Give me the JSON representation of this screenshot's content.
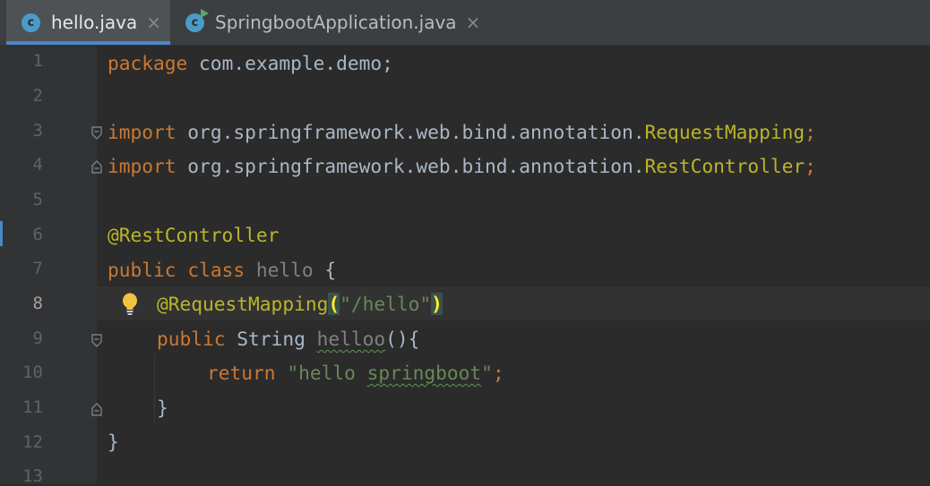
{
  "tabs": [
    {
      "label": "hello.java",
      "icon": "class-icon",
      "active": true
    },
    {
      "label": "SpringbootApplication.java",
      "icon": "class-run-icon",
      "active": false
    }
  ],
  "line_numbers": [
    "1",
    "2",
    "3",
    "4",
    "5",
    "6",
    "7",
    "8",
    "9",
    "10",
    "11",
    "12",
    "13"
  ],
  "current_line": 8,
  "code": {
    "l1": {
      "kw": "package",
      "rest": " com.example.demo;"
    },
    "l3": {
      "kw": "import",
      "pkg": " org.springframework.web.bind.annotation.",
      "cls": "RequestMapping",
      "semi": ";"
    },
    "l4": {
      "kw": "import",
      "pkg": " org.springframework.web.bind.annotation.",
      "cls": "RestController",
      "semi": ";"
    },
    "l6": {
      "ann": "@RestController"
    },
    "l7": {
      "kw1": "public",
      "kw2": "class",
      "name": "hello",
      "brace": " {"
    },
    "l8": {
      "ann": "@RequestMapping",
      "lparen": "(",
      "str": "\"/hello\"",
      "rparen": ")"
    },
    "l9": {
      "kw": "public",
      "type": " String ",
      "method": "helloo",
      "rest": "(){"
    },
    "l10": {
      "kw": "return",
      "str_a": "\"hello ",
      "str_b": "springboot",
      "str_c": "\"",
      "semi": ";"
    },
    "l11": {
      "text": "}"
    },
    "l12": {
      "text": "}"
    }
  },
  "colors": {
    "keyword": "#cc7832",
    "annotation": "#bbb529",
    "string": "#6a8759",
    "default": "#a9b7c6",
    "background": "#2b2b2b",
    "accent": "#4a88c7"
  }
}
